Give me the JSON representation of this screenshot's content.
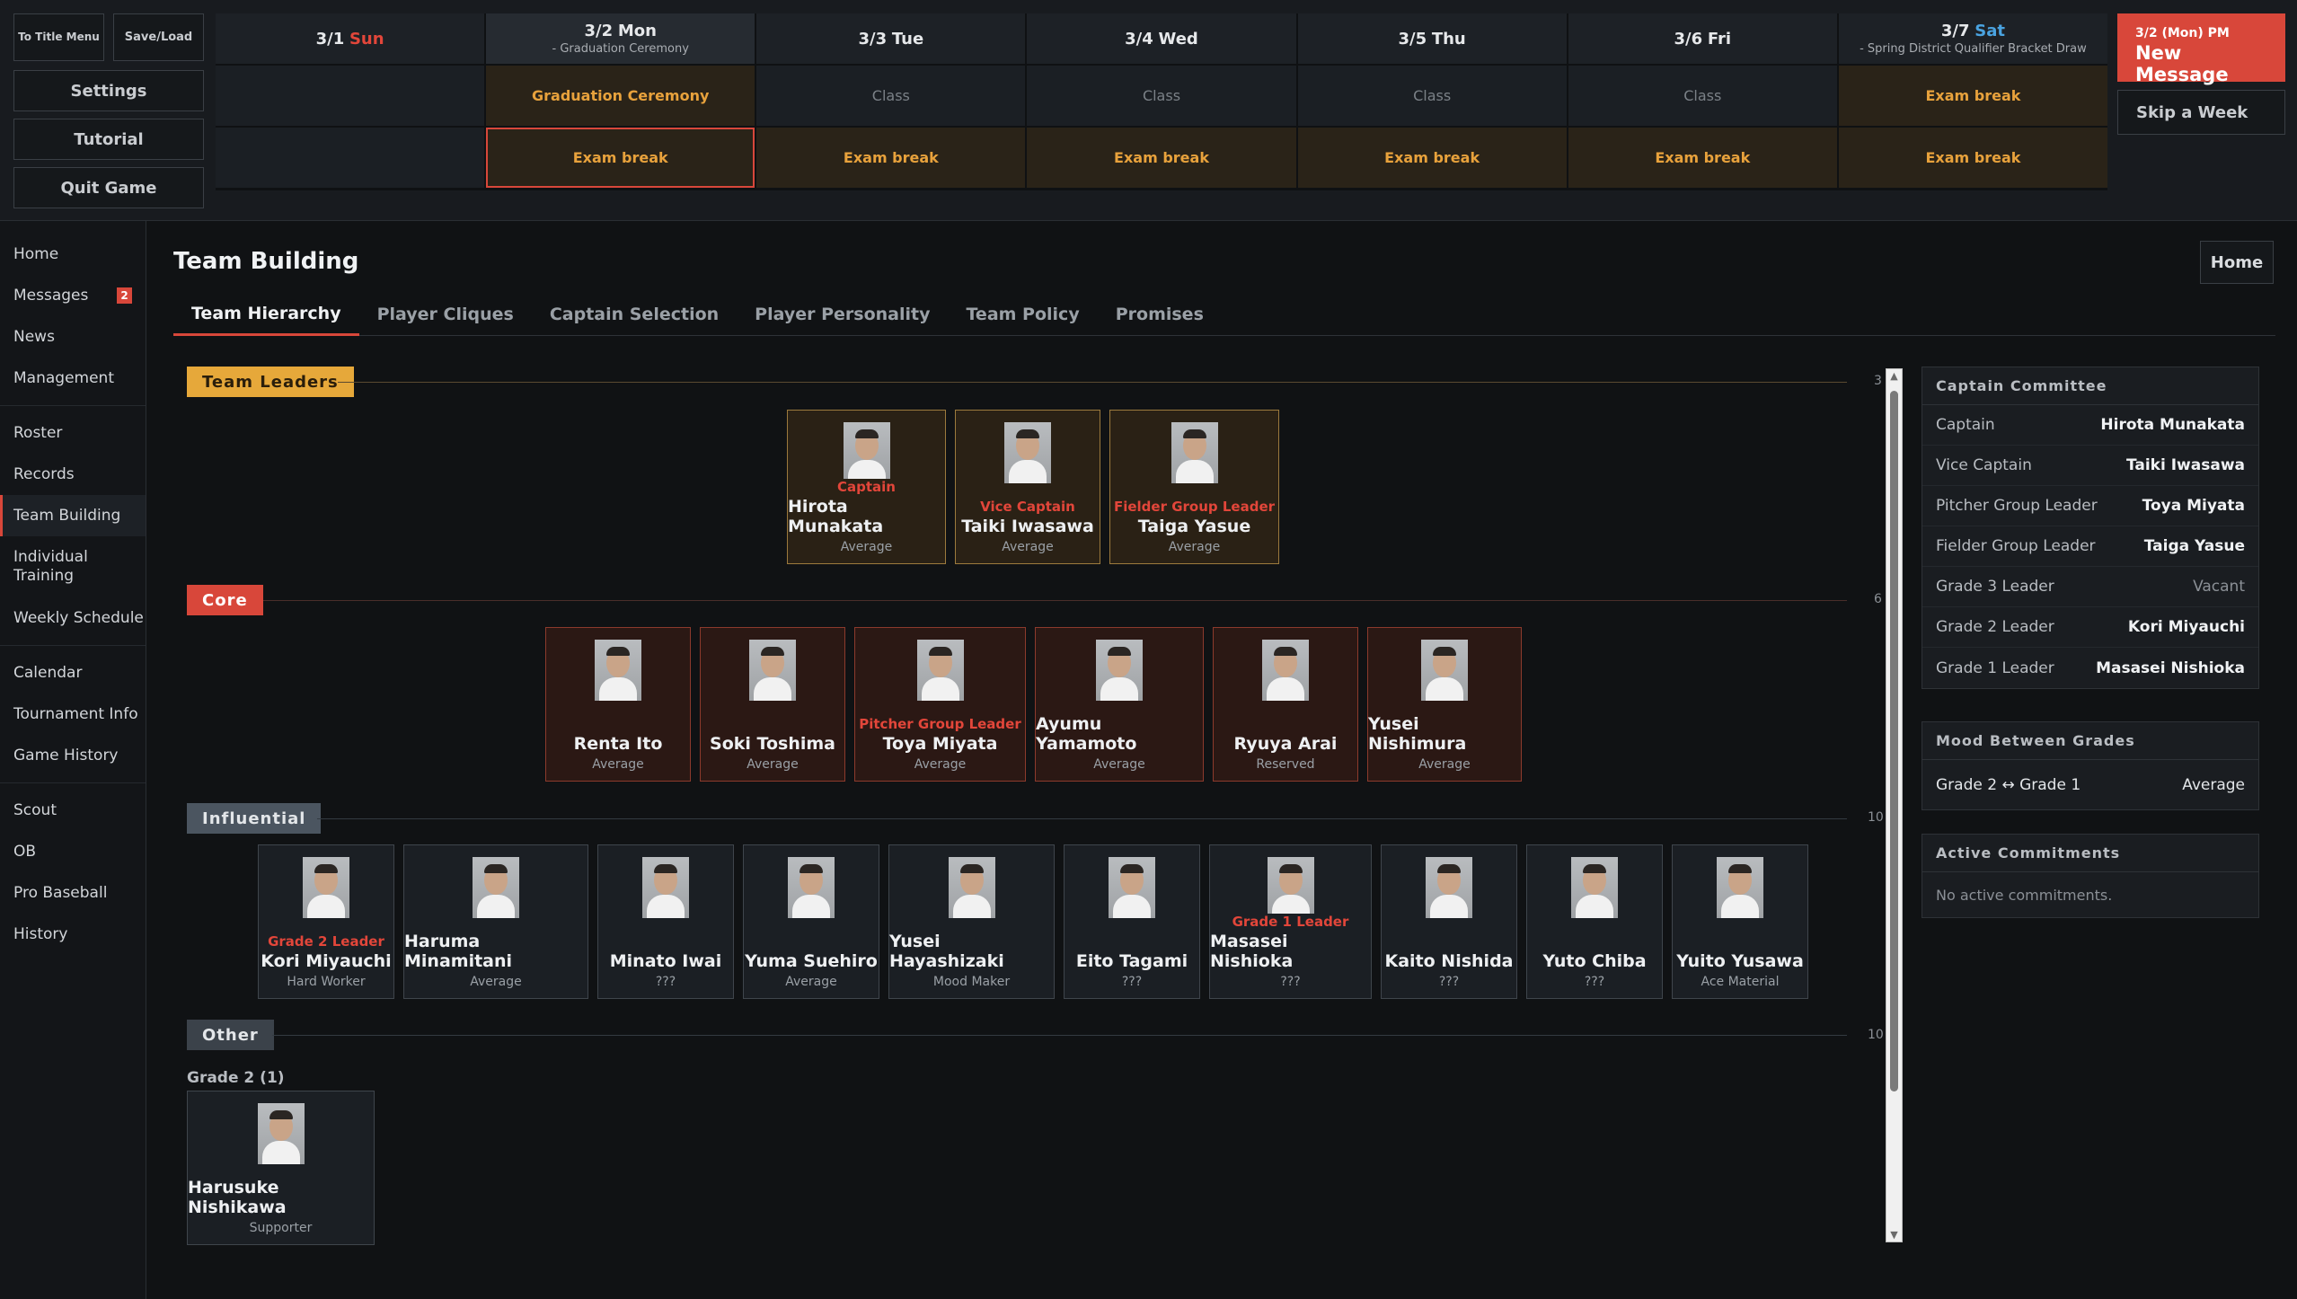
{
  "top": {
    "to_title": "To Title Menu",
    "save_load": "Save/Load",
    "settings": "Settings",
    "tutorial": "Tutorial",
    "quit": "Quit Game",
    "message_date": "3/2 (Mon) PM",
    "message_label": "New Message",
    "skip_week": "Skip a Week"
  },
  "calendar": {
    "days": [
      {
        "date": "3/1",
        "weekday": "Sun",
        "sub": ""
      },
      {
        "date": "3/2",
        "weekday": "Mon",
        "sub": "- Graduation Ceremony"
      },
      {
        "date": "3/3",
        "weekday": "Tue",
        "sub": ""
      },
      {
        "date": "3/4",
        "weekday": "Wed",
        "sub": ""
      },
      {
        "date": "3/5",
        "weekday": "Thu",
        "sub": ""
      },
      {
        "date": "3/6",
        "weekday": "Fri",
        "sub": ""
      },
      {
        "date": "3/7",
        "weekday": "Sat",
        "sub": "- Spring District Qualifier Bracket Draw"
      }
    ],
    "row1": [
      "",
      "Graduation Ceremony",
      "Class",
      "Class",
      "Class",
      "Class",
      "Exam break"
    ],
    "row2": [
      "",
      "Exam break",
      "Exam break",
      "Exam break",
      "Exam break",
      "Exam break",
      "Exam break"
    ]
  },
  "sidebar": {
    "items": [
      "Home",
      "Messages",
      "News",
      "Management",
      "Roster",
      "Records",
      "Team Building",
      "Individual Training",
      "Weekly Schedule",
      "Calendar",
      "Tournament Info",
      "Game History",
      "Scout",
      "OB",
      "Pro Baseball",
      "History"
    ],
    "messages_badge": "2"
  },
  "main": {
    "title": "Team Building",
    "home_button": "Home",
    "tabs": [
      "Team Hierarchy",
      "Player Cliques",
      "Captain Selection",
      "Player Personality",
      "Team Policy",
      "Promises"
    ]
  },
  "hierarchy": {
    "leaders": {
      "label": "Team Leaders",
      "count": "3",
      "players": [
        {
          "role": "Captain",
          "name": "Hirota Munakata",
          "trait": "Average"
        },
        {
          "role": "Vice Captain",
          "name": "Taiki Iwasawa",
          "trait": "Average"
        },
        {
          "role": "Fielder Group Leader",
          "name": "Taiga Yasue",
          "trait": "Average"
        }
      ]
    },
    "core": {
      "label": "Core",
      "count": "6",
      "players": [
        {
          "role": "",
          "name": "Renta Ito",
          "trait": "Average"
        },
        {
          "role": "",
          "name": "Soki Toshima",
          "trait": "Average"
        },
        {
          "role": "Pitcher Group Leader",
          "name": "Toya Miyata",
          "trait": "Average"
        },
        {
          "role": "",
          "name": "Ayumu Yamamoto",
          "trait": "Average"
        },
        {
          "role": "",
          "name": "Ryuya Arai",
          "trait": "Reserved"
        },
        {
          "role": "",
          "name": "Yusei Nishimura",
          "trait": "Average"
        }
      ]
    },
    "influential": {
      "label": "Influential",
      "count": "10",
      "players": [
        {
          "role": "Grade 2 Leader",
          "name": "Kori Miyauchi",
          "trait": "Hard Worker"
        },
        {
          "role": "",
          "name": "Haruma Minamitani",
          "trait": "Average"
        },
        {
          "role": "",
          "name": "Minato Iwai",
          "trait": "???"
        },
        {
          "role": "",
          "name": "Yuma Suehiro",
          "trait": "Average"
        },
        {
          "role": "",
          "name": "Yusei Hayashizaki",
          "trait": "Mood Maker"
        },
        {
          "role": "",
          "name": "Eito Tagami",
          "trait": "???"
        },
        {
          "role": "Grade 1 Leader",
          "name": "Masasei Nishioka",
          "trait": "???"
        },
        {
          "role": "",
          "name": "Kaito Nishida",
          "trait": "???"
        },
        {
          "role": "",
          "name": "Yuto Chiba",
          "trait": "???"
        },
        {
          "role": "",
          "name": "Yuito Yusawa",
          "trait": "Ace Material"
        }
      ]
    },
    "other": {
      "label": "Other",
      "count": "10",
      "grade_label": "Grade 2 (1)",
      "players": [
        {
          "role": "",
          "name": "Harusuke Nishikawa",
          "trait": "Supporter"
        }
      ]
    }
  },
  "committee": {
    "title": "Captain Committee",
    "rows": [
      {
        "k": "Captain",
        "v": "Hirota Munakata"
      },
      {
        "k": "Vice Captain",
        "v": "Taiki Iwasawa"
      },
      {
        "k": "Pitcher Group Leader",
        "v": "Toya Miyata"
      },
      {
        "k": "Fielder Group Leader",
        "v": "Taiga Yasue"
      },
      {
        "k": "Grade 3 Leader",
        "v": "Vacant"
      },
      {
        "k": "Grade 2 Leader",
        "v": "Kori Miyauchi"
      },
      {
        "k": "Grade 1 Leader",
        "v": "Masasei Nishioka"
      }
    ]
  },
  "mood": {
    "title": "Mood Between Grades",
    "k": "Grade 2 ↔ Grade 1",
    "v": "Average"
  },
  "commitments": {
    "title": "Active Commitments",
    "text": "No active commitments."
  },
  "colors": {
    "accent": "#d8473a",
    "leader_tag": "#e6a83a",
    "core_tag": "#d8473a",
    "influential_tag": "#4b5560",
    "other_tag": "#3b424a",
    "sunday": "#e2463a",
    "saturday": "#4aa3e0"
  }
}
